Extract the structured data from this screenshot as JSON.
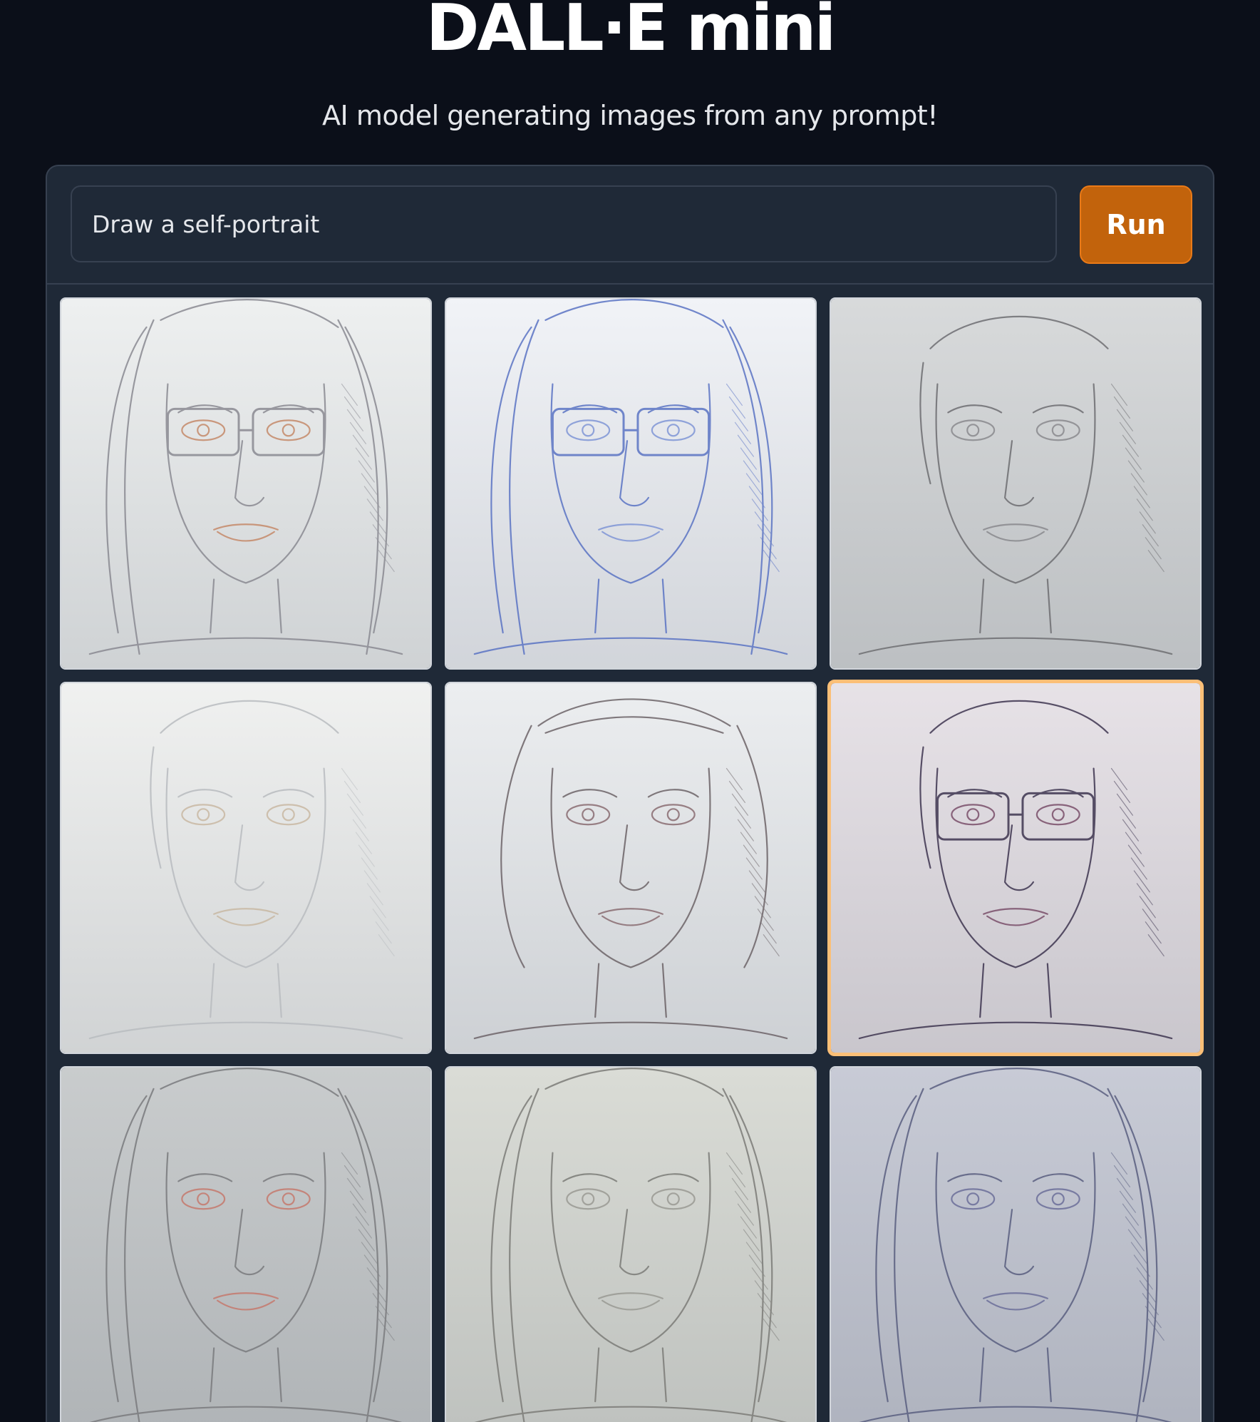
{
  "header": {
    "title": "DALL·E mini",
    "subtitle": "AI model generating images from any prompt!"
  },
  "prompt": {
    "value": "Draw a self-portrait",
    "run_label": "Run"
  },
  "gallery": {
    "selected_index": 5,
    "images": [
      {
        "name": "portrait-1",
        "bg": "#eef0f0",
        "stroke": "#8a8a92",
        "accent": "#c58a6a",
        "glasses": true,
        "hair": "long"
      },
      {
        "name": "portrait-2",
        "bg": "#f1f3f7",
        "stroke": "#5b74c4",
        "accent": "#8096d6",
        "glasses": true,
        "hair": "long"
      },
      {
        "name": "portrait-3",
        "bg": "#d8dadb",
        "stroke": "#6e6e72",
        "accent": "#8a8a8e",
        "glasses": false,
        "hair": "short"
      },
      {
        "name": "portrait-4",
        "bg": "#f0f1f0",
        "stroke": "#b9bcc0",
        "accent": "#c9b9a4",
        "glasses": false,
        "hair": "short"
      },
      {
        "name": "portrait-5",
        "bg": "#eceef0",
        "stroke": "#6d6468",
        "accent": "#8a6d72",
        "glasses": false,
        "hair": "bob"
      },
      {
        "name": "portrait-6",
        "bg": "#e7e2e7",
        "stroke": "#3e3550",
        "accent": "#7a4f6a",
        "glasses": true,
        "hair": "short"
      },
      {
        "name": "portrait-7",
        "bg": "#c9cccd",
        "stroke": "#7a7b7e",
        "accent": "#c57a6e",
        "glasses": false,
        "hair": "long"
      },
      {
        "name": "portrait-8",
        "bg": "#dadcd6",
        "stroke": "#7c7c78",
        "accent": "#9a9a94",
        "glasses": false,
        "hair": "long"
      },
      {
        "name": "portrait-9",
        "bg": "#c8cbd6",
        "stroke": "#5a5f80",
        "accent": "#6c6f9a",
        "glasses": false,
        "hair": "long"
      }
    ]
  }
}
